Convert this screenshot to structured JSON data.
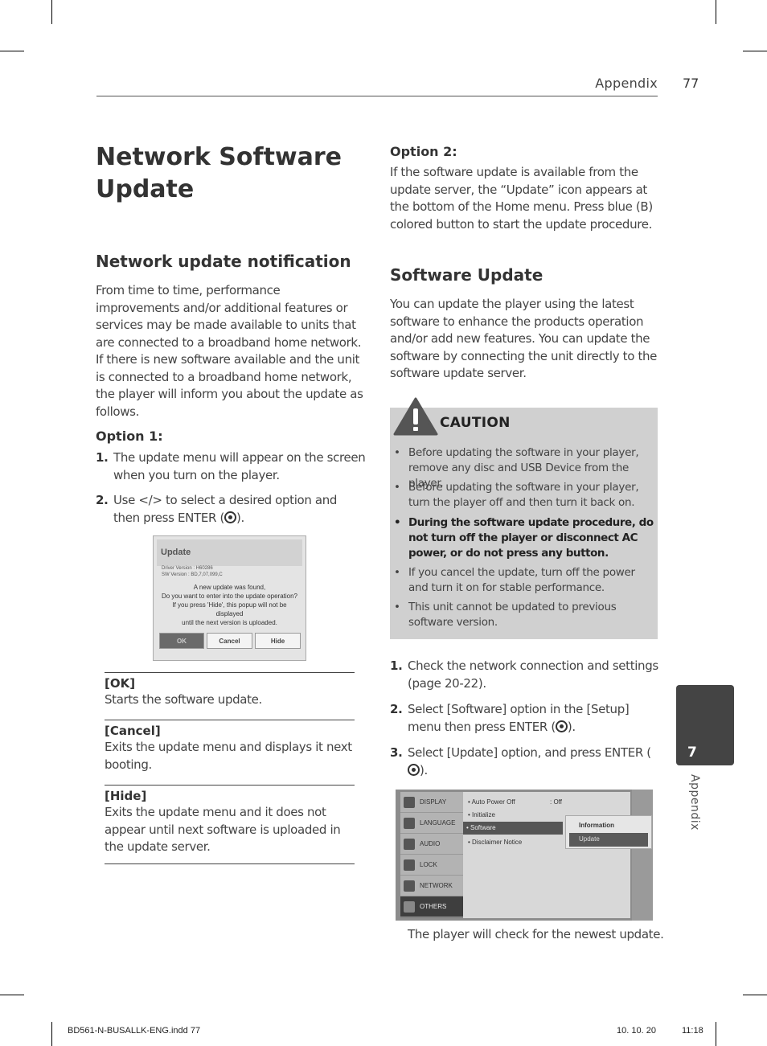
{
  "header": {
    "section": "Appendix",
    "page_number": "77"
  },
  "title": "Network Software Update",
  "left": {
    "notification_heading": "Network update notification",
    "notification_text": "From time to time, performance improvements and/or additional features or services may be made available to units that are connected to a broadband home network. If there is new software available and the unit is connected to a broadband home network, the player will inform you about the update as follows.",
    "option1_heading": "Option 1:",
    "steps": [
      {
        "num": "1.",
        "text": "The update menu will appear on the screen when you turn on the player."
      },
      {
        "num": "2.",
        "text_before": "Use </> to select a desired option and then press ENTER (",
        "text_after": ")."
      }
    ],
    "dialog": {
      "title": "Update",
      "driver_version": "Driver Version : H60286",
      "sw_version": "SW Version : BD,7,07,099,C",
      "message_lines": [
        "A new update was found,",
        "Do you want to enter into the update operation?",
        "If you press 'Hide', this popup will not be displayed",
        "until the next version is uploaded."
      ],
      "buttons": [
        "OK",
        "Cancel",
        "Hide"
      ]
    },
    "definitions": [
      {
        "term": "[OK]",
        "desc": "Starts the software update."
      },
      {
        "term": "[Cancel]",
        "desc": "Exits the update menu and displays it next booting."
      },
      {
        "term": "[Hide]",
        "desc": "Exits the update menu and it does not appear until next software is uploaded in the update server."
      }
    ]
  },
  "right": {
    "option2_heading": "Option 2:",
    "option2_text": "If the software update is available from the update server, the “Update” icon appears at the bottom of the Home menu. Press blue (B) colored button to start the update procedure.",
    "software_heading": "Software Update",
    "software_text": "You can update the player using the latest software to enhance the products operation and/or add new features. You can update the software by connecting the unit directly to the software update server.",
    "caution": {
      "title": "CAUTION",
      "items": [
        {
          "text": "Before updating the software in your player, remove any disc and USB Device from the player.",
          "bold": false
        },
        {
          "text": "Before updating the software in your player, turn the player off and then turn it back on.",
          "bold": false
        },
        {
          "text": "During the software update procedure, do not turn off the player or disconnect AC power, or do not press any button.",
          "bold": true
        },
        {
          "text": "If you cancel the update, turn off the power and turn it on for stable performance.",
          "bold": false
        },
        {
          "text": "This unit cannot be updated to previous software version.",
          "bold": false
        }
      ]
    },
    "steps": [
      {
        "num": "1.",
        "text": "Check the network connection and settings (page 20-22)."
      },
      {
        "num": "2.",
        "text_before": "Select [Software] option in the [Setup] menu then press ENTER (",
        "text_after": ")."
      },
      {
        "num": "3.",
        "text_before": "Select [Update] option, and press ENTER (",
        "text_after": ")."
      }
    ],
    "menu": {
      "left_items": [
        "DISPLAY",
        "LANGUAGE",
        "AUDIO",
        "LOCK",
        "NETWORK",
        "OTHERS"
      ],
      "selected_left": "OTHERS",
      "right_items": [
        "• Auto Power Off",
        "• Initialize",
        "• Software",
        "• Disclaimer Notice"
      ],
      "auto_power_value": ": Off",
      "submenu": [
        "Information",
        "Update"
      ]
    },
    "closing_text": "The player will check for the newest update."
  },
  "side_tab": {
    "number": "7",
    "label": "Appendix"
  },
  "footer": {
    "file": "BD561-N-BUSALLK-ENG.indd   77",
    "date": "10. 10. 20",
    "time": "11:18"
  }
}
